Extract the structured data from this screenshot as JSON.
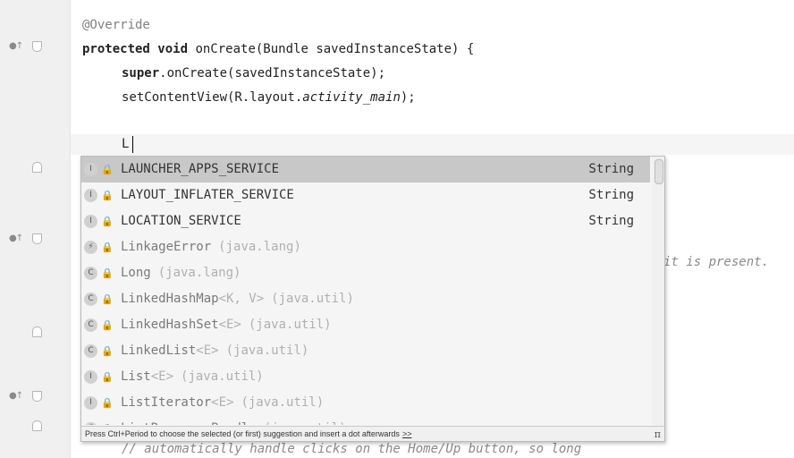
{
  "editor": {
    "lines": {
      "override": "@Override",
      "kw_protected": "protected",
      "kw_void": "void",
      "method_sig": "onCreate(Bundle savedInstanceState) {",
      "kw_super": "super",
      "super_call": ".onCreate(savedInstanceState);",
      "set_content_prefix": "setContentView(R.layout.",
      "set_content_field": "activity_main",
      "set_content_suffix": ");",
      "typed": "L",
      "behind_comment": "it is present.",
      "bottom_comment": "// automatically handle clicks on the Home/Up button, so long"
    },
    "gutter_icons": {
      "override_marker": "●↑"
    }
  },
  "completion": {
    "items": [
      {
        "kind": "I",
        "name": "LAUNCHER_APPS_SERVICE",
        "type": "String",
        "selected": true
      },
      {
        "kind": "I",
        "name": "LAYOUT_INFLATER_SERVICE",
        "type": "String"
      },
      {
        "kind": "I",
        "name": "LOCATION_SERVICE",
        "type": "String"
      },
      {
        "kind": "⚡",
        "name": "LinkageError",
        "pkg": "(java.lang)",
        "dim": true
      },
      {
        "kind": "C",
        "name": "Long",
        "pkg": "(java.lang)",
        "dim": true
      },
      {
        "kind": "C",
        "name": "LinkedHashMap",
        "generic": "<K, V>",
        "pkg": "(java.util)",
        "dim": true
      },
      {
        "kind": "C",
        "name": "LinkedHashSet",
        "generic": "<E>",
        "pkg": "(java.util)",
        "dim": true
      },
      {
        "kind": "C",
        "name": "LinkedList",
        "generic": "<E>",
        "pkg": "(java.util)",
        "dim": true
      },
      {
        "kind": "I",
        "name": "List",
        "generic": "<E>",
        "pkg": "(java.util)",
        "dim": true
      },
      {
        "kind": "I",
        "name": "ListIterator",
        "generic": "<E>",
        "pkg": "(java.util)",
        "dim": true
      },
      {
        "kind": "C",
        "name": "ListResourceBundle",
        "pkg": "(java.util)",
        "dim": true
      }
    ],
    "footer_text": "Press Ctrl+Period to choose the selected (or first) suggestion and insert a dot afterwards",
    "footer_link": ">>",
    "footer_pi": "π"
  }
}
